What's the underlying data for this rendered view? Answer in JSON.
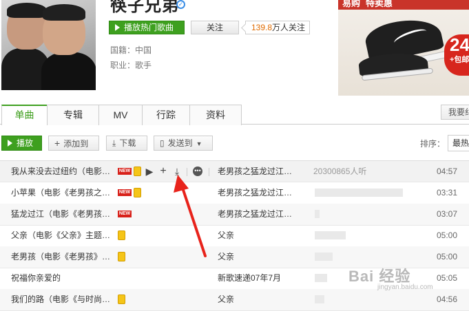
{
  "artist": {
    "name": "筷子兄弟",
    "play_hot_label": "播放热门歌曲",
    "follow_label": "关注",
    "follow_count": "139.8",
    "follow_suffix": "万人关注",
    "nationality": "国籍：中国",
    "occupation": "职业：歌手"
  },
  "ad": {
    "line1": "易购",
    "line2": "特卖惠",
    "badge_big": "24",
    "badge_small": "+包邮"
  },
  "tabs": [
    "单曲",
    "专辑",
    "MV",
    "行踪",
    "资料"
  ],
  "ask_button": "我要纠",
  "toolbar": {
    "play": "播放",
    "add_to": "添加到",
    "download": "下载",
    "send_to": "发送到",
    "sort_label": "排序：",
    "sort_value": "最热"
  },
  "songs": [
    {
      "title": "我从来没去过纽约（电影…",
      "album": "老男孩之猛龙过江…",
      "listens": "20300865人听",
      "duration": "04:57"
    },
    {
      "title": "小苹果（电影《老男孩之…",
      "album": "老男孩之猛龙过江…",
      "duration": "03:31"
    },
    {
      "title": "猛龙过江（电影《老男孩…",
      "album": "老男孩之猛龙过江…",
      "duration": "03:07"
    },
    {
      "title": "父亲（电影《父亲》主题…",
      "album": "父亲",
      "duration": "05:00"
    },
    {
      "title": "老男孩（电影《老男孩》…",
      "album": "父亲",
      "duration": "05:00"
    },
    {
      "title": "祝福你亲爱的",
      "album": "新歌速递07年7月",
      "duration": "05:05"
    },
    {
      "title": "我们的路（电影《与时尚…",
      "album": "父亲",
      "duration": "04:56"
    }
  ],
  "popularity": [
    1.0,
    0.9,
    0.05,
    0.32,
    0.18,
    0.13,
    0.1
  ],
  "watermark": {
    "main": "Bai 经验",
    "sub": "jingyan.baidu.com"
  }
}
